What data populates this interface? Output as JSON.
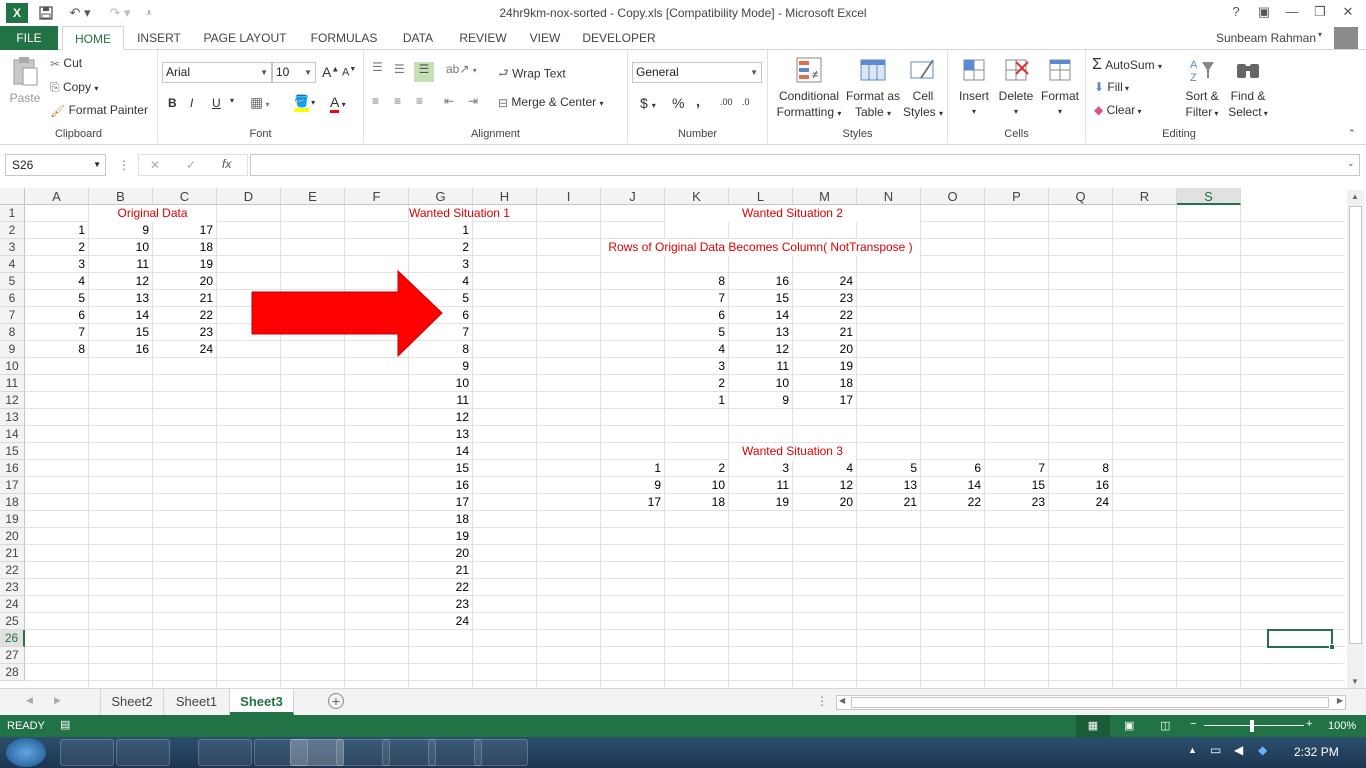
{
  "window": {
    "title": "24hr9km-nox-sorted - Copy.xls  [Compatibility Mode] - Microsoft Excel",
    "help_btn": "?",
    "user": "Sunbeam Rahman"
  },
  "tabs": [
    "FILE",
    "HOME",
    "INSERT",
    "PAGE LAYOUT",
    "FORMULAS",
    "DATA",
    "REVIEW",
    "VIEW",
    "DEVELOPER"
  ],
  "ribbon": {
    "clipboard": {
      "paste": "Paste",
      "cut": "Cut",
      "copy": "Copy",
      "format_painter": "Format Painter",
      "label": "Clipboard"
    },
    "font": {
      "name": "Arial",
      "size": "10",
      "bold": "B",
      "italic": "I",
      "underline": "U",
      "grow": "A",
      "shrink": "A",
      "color_a": "A",
      "label": "Font"
    },
    "alignment": {
      "wrap": "Wrap Text",
      "merge": "Merge & Center",
      "label": "Alignment"
    },
    "number": {
      "format": "General",
      "currency": "$",
      "percent": "%",
      "comma": ",",
      "inc_dec": ".00",
      "dec_dec": ".0",
      "label": "Number"
    },
    "styles": {
      "conditional": "Conditional",
      "conditional2": "Formatting",
      "format_as": "Format as",
      "format_as2": "Table",
      "cell": "Cell",
      "cell2": "Styles",
      "label": "Styles"
    },
    "cells": {
      "insert": "Insert",
      "delete": "Delete",
      "format": "Format",
      "label": "Cells"
    },
    "editing": {
      "autosum": "AutoSum",
      "fill": "Fill",
      "clear": "Clear",
      "sort": "Sort &",
      "sort2": "Filter",
      "find": "Find &",
      "find2": "Select",
      "label": "Editing"
    }
  },
  "formula_bar": {
    "name_box": "S26",
    "cancel": "✕",
    "enter": "✓",
    "fx": "fx",
    "content": ""
  },
  "columns": [
    "A",
    "B",
    "C",
    "D",
    "E",
    "F",
    "G",
    "H",
    "I",
    "J",
    "K",
    "L",
    "M",
    "N",
    "O",
    "P",
    "Q",
    "R",
    "S"
  ],
  "rows": [
    "1",
    "2",
    "3",
    "4",
    "5",
    "6",
    "7",
    "8",
    "9",
    "10",
    "11",
    "12",
    "13",
    "14",
    "15",
    "16",
    "17",
    "18",
    "19",
    "20",
    "21",
    "22",
    "23",
    "24",
    "25",
    "26",
    "27",
    "28"
  ],
  "selected_col": "S",
  "selected_row": "26",
  "labels": {
    "original": "Original Data",
    "wanted1": "Wanted Situation 1",
    "wanted2": "Wanted Situation 2",
    "rows_become": "Rows of Original Data Becomes Column( NotTranspose )",
    "wanted3": "Wanted Situation 3"
  },
  "original_data": [
    [
      1,
      9,
      17
    ],
    [
      2,
      10,
      18
    ],
    [
      3,
      11,
      19
    ],
    [
      4,
      12,
      20
    ],
    [
      5,
      13,
      21
    ],
    [
      6,
      14,
      22
    ],
    [
      7,
      15,
      23
    ],
    [
      8,
      16,
      24
    ]
  ],
  "wanted1_values": [
    1,
    2,
    3,
    4,
    5,
    6,
    7,
    8,
    9,
    10,
    11,
    12,
    13,
    14,
    15,
    16,
    17,
    18,
    19,
    20,
    21,
    22,
    23,
    24
  ],
  "wanted2_data": [
    [
      8,
      16,
      24
    ],
    [
      7,
      15,
      23
    ],
    [
      6,
      14,
      22
    ],
    [
      5,
      13,
      21
    ],
    [
      4,
      12,
      20
    ],
    [
      3,
      11,
      19
    ],
    [
      2,
      10,
      18
    ],
    [
      1,
      9,
      17
    ]
  ],
  "wanted3_data": [
    [
      1,
      2,
      3,
      4,
      5,
      6,
      7,
      8
    ],
    [
      9,
      10,
      11,
      12,
      13,
      14,
      15,
      16
    ],
    [
      17,
      18,
      19,
      20,
      21,
      22,
      23,
      24
    ]
  ],
  "sheets": [
    "Sheet2",
    "Sheet1",
    "Sheet3"
  ],
  "active_sheet": "Sheet3",
  "status": {
    "ready": "READY",
    "zoom": "100%"
  },
  "taskbar": {
    "time": "2:32 PM"
  },
  "colors": {
    "excel_green": "#217346",
    "arrow_red": "#ff0000",
    "label_red": "#e00000"
  }
}
